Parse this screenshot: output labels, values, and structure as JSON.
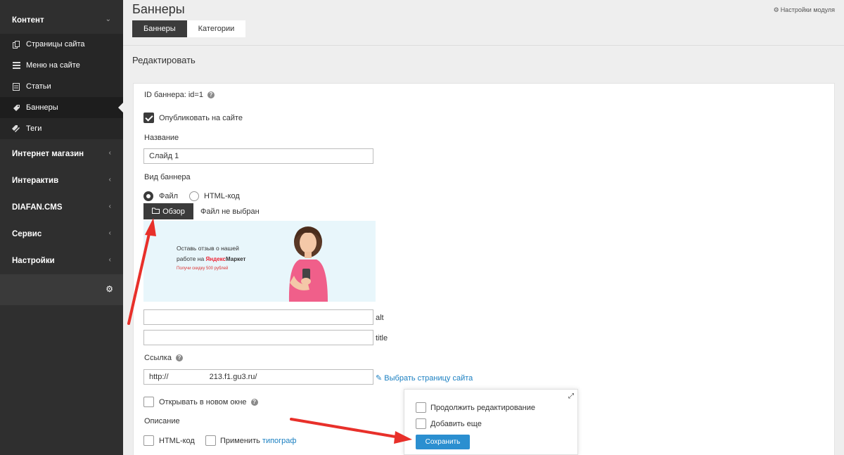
{
  "sidebar": {
    "content_section": "Контент",
    "items": [
      {
        "label": "Страницы сайта",
        "icon": "copy-icon"
      },
      {
        "label": "Меню на сайте",
        "icon": "list-icon"
      },
      {
        "label": "Статьи",
        "icon": "document-icon"
      },
      {
        "label": "Баннеры",
        "icon": "tag-icon"
      },
      {
        "label": "Теги",
        "icon": "tags-icon"
      }
    ],
    "sections": [
      "Интернет магазин",
      "Интерактив",
      "DIAFAN.CMS",
      "Сервис",
      "Настройки"
    ]
  },
  "header": {
    "title": "Баннеры",
    "module_settings": "Настройки модуля",
    "tabs": [
      "Баннеры",
      "Категории"
    ],
    "section_title": "Редактировать"
  },
  "form": {
    "banner_id": "ID баннера: id=1",
    "publish_label": "Опубликовать на сайте",
    "name_label": "Название",
    "name_value": "Слайд 1",
    "type_label": "Вид баннера",
    "type_file": "Файл",
    "type_html": "HTML-код",
    "browse_button": "Обзор",
    "no_file": "Файл не выбран",
    "alt_label": "alt",
    "title_label": "title",
    "link_label": "Ссылка",
    "link_value": "http://                   213.f1.gu3.ru/",
    "choose_page": "Выбрать страницу сайта",
    "new_window_label": "Открывать в новом окне",
    "description_label": "Описание",
    "html_code_label": "HTML-код",
    "apply_label": "Применить",
    "typograph_link": "типограф"
  },
  "banner_image": {
    "line1": "Оставь отзыв о нашей",
    "line2_prefix": "работе на",
    "brand_yandex": "Яндекс",
    "brand_market": "Маркет",
    "line3": "Получи скидку 500 рублей"
  },
  "save_panel": {
    "continue_label": "Продолжить редактирование",
    "add_more_label": "Добавить еще",
    "save_button": "Сохранить"
  },
  "colors": {
    "sidebar_bg": "#2f2f2f",
    "accent_dark": "#3b3b3b",
    "save_blue": "#2b8fd0",
    "link_blue": "#1a7fc1",
    "arrow_red": "#e8302a"
  }
}
